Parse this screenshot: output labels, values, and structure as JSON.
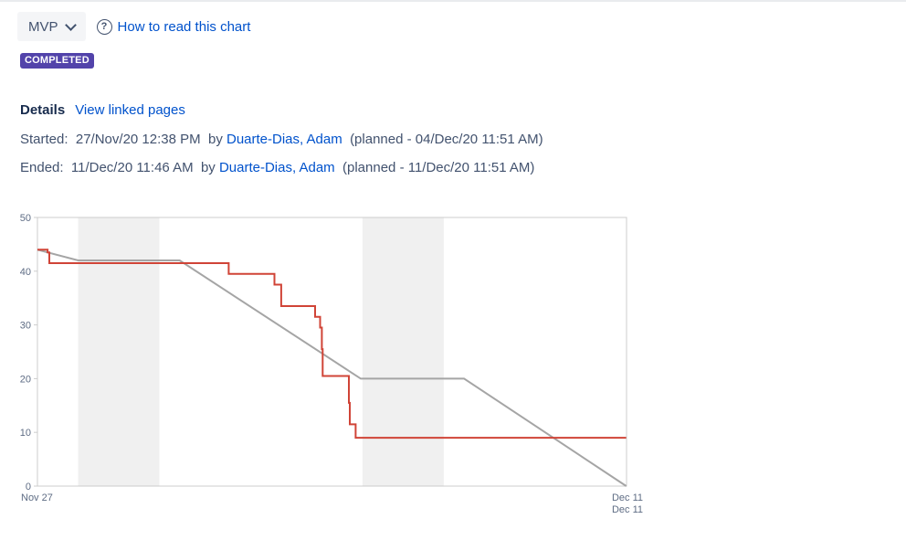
{
  "header": {
    "sprint_select": {
      "value": "MVP",
      "icon": "chevron-down-icon"
    },
    "help_link": {
      "label": "How to read this chart",
      "icon": "question-circle-icon"
    }
  },
  "status_badge": {
    "label": "COMPLETED",
    "color": "#5243aa"
  },
  "details": {
    "label": "Details",
    "link": "View linked pages",
    "started": {
      "label": "Started:",
      "date": "27/Nov/20 12:38 PM",
      "by_label": "by",
      "by": "Duarte-Dias, Adam",
      "planned": "(planned - 04/Dec/20 11:51 AM)"
    },
    "ended": {
      "label": "Ended:",
      "date": "11/Dec/20 11:46 AM",
      "by_label": "by",
      "by": "Duarte-Dias, Adam",
      "planned": "(planned - 11/Dec/20 11:51 AM)"
    }
  },
  "chart_data": {
    "type": "line",
    "x_tick_labels": [
      "Nov 27",
      "Dec 11"
    ],
    "x_end_sublabel": "Dec 11",
    "y_ticks": [
      0,
      10,
      20,
      30,
      40,
      50
    ],
    "ylim": [
      0,
      50
    ],
    "xlim": [
      "2020-11-27",
      "2020-12-11"
    ],
    "non_working_ranges": [
      [
        "2020-11-28",
        "2020-11-30"
      ],
      [
        "2020-12-05",
        "2020-12-07"
      ]
    ],
    "non_working_color": "#f0f0f0",
    "series": [
      {
        "color": "#d04437",
        "points": [
          [
            "2020-11-27T00:00",
            44
          ],
          [
            "2020-11-27T06:00",
            44
          ],
          [
            "2020-11-27T06:00",
            43.5
          ],
          [
            "2020-11-27T07:00",
            43.5
          ],
          [
            "2020-11-27T07:00",
            41.5
          ],
          [
            "2020-12-01T17:00",
            41.5
          ],
          [
            "2020-12-01T17:00",
            39.5
          ],
          [
            "2020-12-02T20:00",
            39.5
          ],
          [
            "2020-12-02T20:00",
            37.5
          ],
          [
            "2020-12-03T00:00",
            37.5
          ],
          [
            "2020-12-03T00:00",
            33.5
          ],
          [
            "2020-12-03T20:00",
            33.5
          ],
          [
            "2020-12-03T20:00",
            31.5
          ],
          [
            "2020-12-03T23:00",
            31.5
          ],
          [
            "2020-12-03T23:00",
            29.5
          ],
          [
            "2020-12-04T00:00",
            29.5
          ],
          [
            "2020-12-04T00:00",
            25.5
          ],
          [
            "2020-12-04T00:30",
            25.5
          ],
          [
            "2020-12-04T00:30",
            20.5
          ],
          [
            "2020-12-04T16:00",
            20.5
          ],
          [
            "2020-12-04T16:00",
            15.5
          ],
          [
            "2020-12-04T16:30",
            15.5
          ],
          [
            "2020-12-04T16:30",
            11.5
          ],
          [
            "2020-12-04T20:00",
            11.5
          ],
          [
            "2020-12-04T20:00",
            9
          ],
          [
            "2020-12-11T11:46",
            9
          ]
        ]
      },
      {
        "color": "#a5a5a5",
        "points": [
          [
            "2020-11-27T00:00",
            44
          ],
          [
            "2020-11-28T00:00",
            42
          ],
          [
            "2020-11-30T12:00",
            42
          ],
          [
            "2020-12-04T23:00",
            20
          ],
          [
            "2020-12-07T12:00",
            20
          ],
          [
            "2020-12-11T11:51",
            0
          ]
        ]
      }
    ],
    "grid": false
  }
}
